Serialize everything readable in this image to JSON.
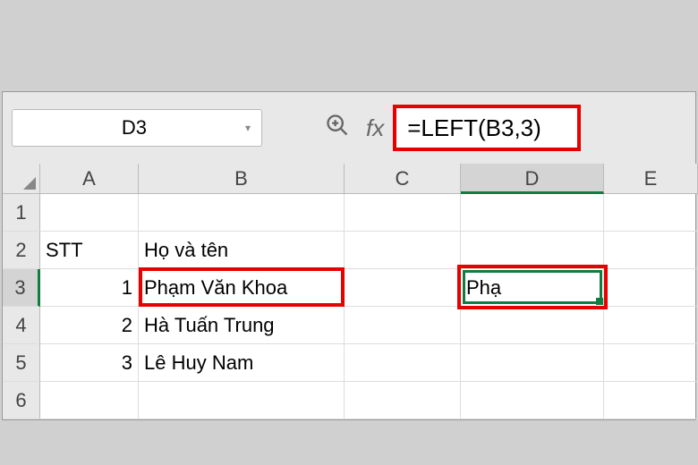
{
  "namebox": {
    "value": "D3"
  },
  "formula": {
    "value": "=LEFT(B3,3)"
  },
  "columns": [
    "A",
    "B",
    "C",
    "D",
    "E"
  ],
  "rows": [
    "1",
    "2",
    "3",
    "4",
    "5",
    "6"
  ],
  "cells": {
    "A2": "STT",
    "B2": "Họ và tên",
    "A3": "1",
    "B3": "Phạm Văn Khoa",
    "D3": "Phạ",
    "A4": "2",
    "B4": "Hà Tuấn Trung",
    "A5": "3",
    "B5": "Lê Huy Nam"
  },
  "active": {
    "cell": "D3",
    "row": "3",
    "col": "D"
  }
}
